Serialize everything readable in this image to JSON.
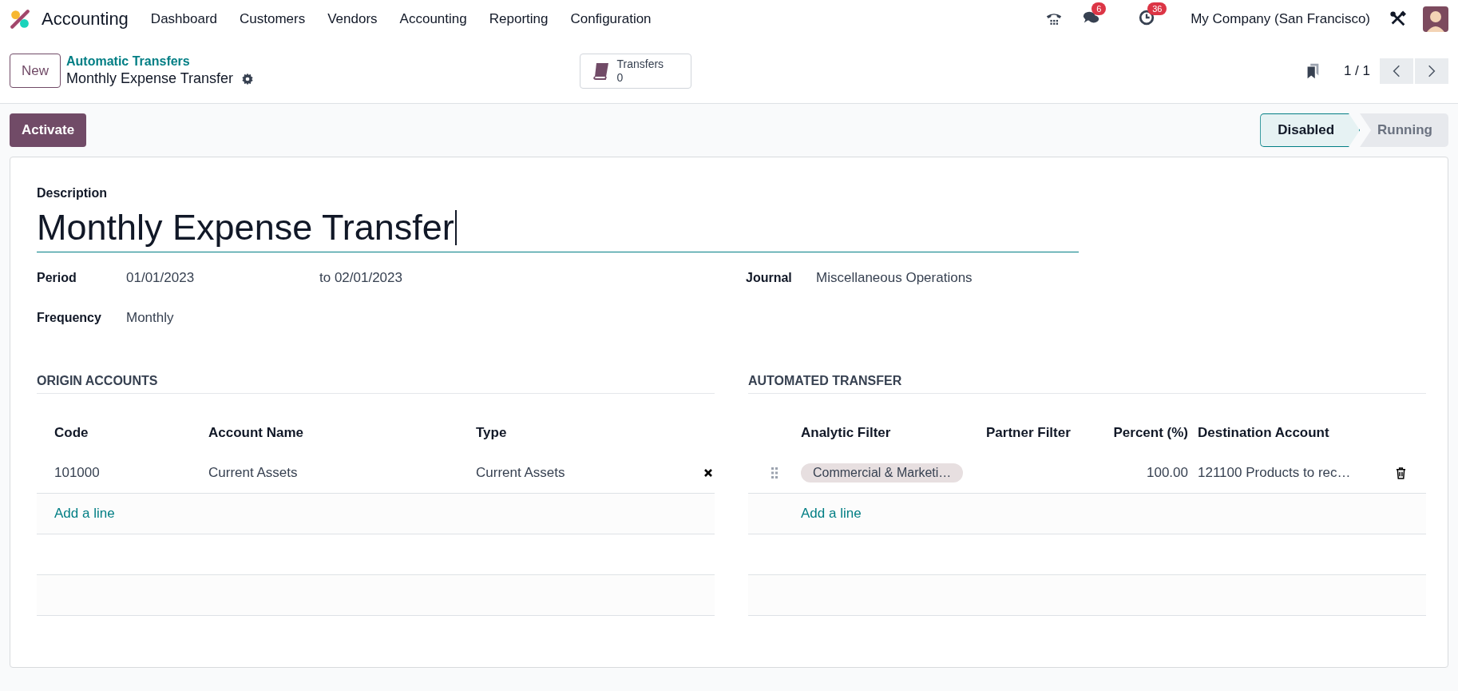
{
  "navbar": {
    "app_name": "Accounting",
    "menu": [
      "Dashboard",
      "Customers",
      "Vendors",
      "Accounting",
      "Reporting",
      "Configuration"
    ],
    "chat_badge": "6",
    "activity_badge": "36",
    "company": "My Company (San Francisco)"
  },
  "control_panel": {
    "new_button": "New",
    "breadcrumb": "Automatic Transfers",
    "record_title": "Monthly Expense Transfer",
    "smart_button": {
      "label": "Transfers",
      "count": "0"
    },
    "pager": "1 / 1"
  },
  "action_button": "Activate",
  "status_steps": [
    {
      "label": "Disabled",
      "selected": true
    },
    {
      "label": "Running",
      "selected": false
    }
  ],
  "form": {
    "description_label": "Description",
    "description": "Monthly Expense Transfer",
    "period_label": "Period",
    "period_from": "01/01/2023",
    "period_to": "to 02/01/2023",
    "journal_label": "Journal",
    "journal": "Miscellaneous Operations",
    "frequency_label": "Frequency",
    "frequency": "Monthly"
  },
  "origin_accounts": {
    "title": "ORIGIN ACCOUNTS",
    "columns": [
      "Code",
      "Account Name",
      "Type"
    ],
    "rows": [
      {
        "code": "101000",
        "name": "Current Assets",
        "type": "Current Assets"
      }
    ],
    "add_line": "Add a line"
  },
  "automated_transfer": {
    "title": "AUTOMATED TRANSFER",
    "columns": [
      "Analytic Filter",
      "Partner Filter",
      "Percent (%)",
      "Destination Account"
    ],
    "rows": [
      {
        "analytic_filter": "Commercial & Marketi…",
        "percent": "100.00",
        "destination": "121100 Products to rec…"
      }
    ],
    "add_line": "Add a line"
  }
}
